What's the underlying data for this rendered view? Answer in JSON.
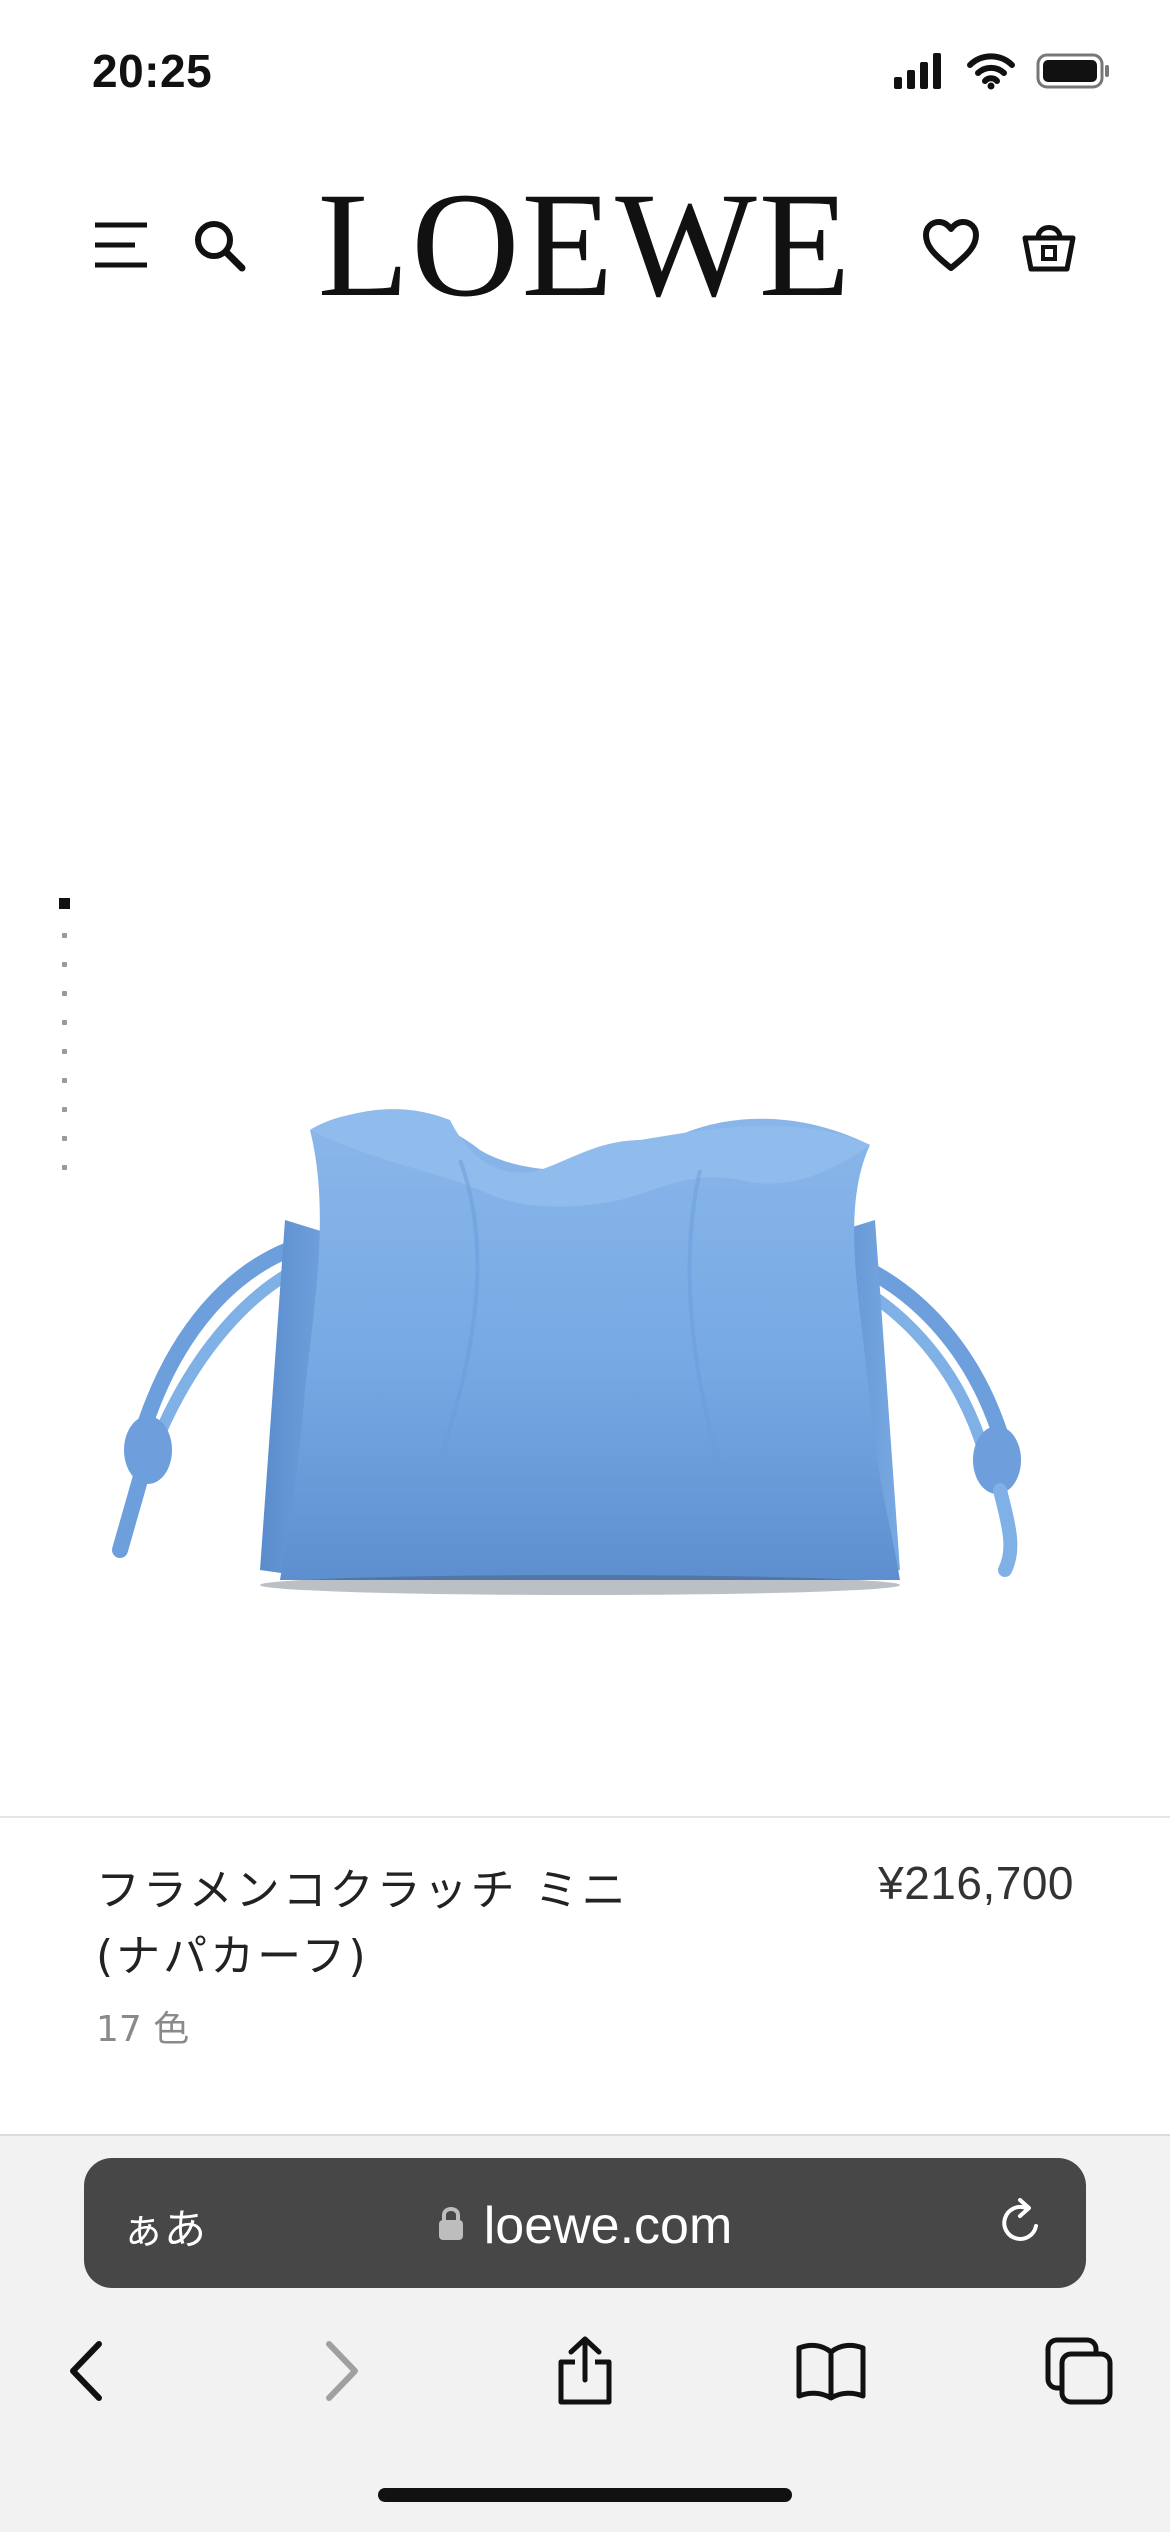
{
  "status_bar": {
    "time": "20:25",
    "icons": [
      "signal-icon",
      "wifi-icon",
      "battery-icon"
    ]
  },
  "header": {
    "logo_text": "LOEWE",
    "icons": [
      "menu-icon",
      "search-icon",
      "heart-icon",
      "basket-icon"
    ]
  },
  "gallery": {
    "image_description_icon": "bag-image",
    "swipe_hint_icon": "swipe-up-hand-icon",
    "page_indicator": {
      "total_dots": 10,
      "active_index": 0
    },
    "actions": [
      "favorite-heart-icon",
      "share-icon"
    ]
  },
  "product": {
    "name_line1": "フラメンコクラッチ ミニ",
    "name_line2": "(ナパカーフ)",
    "price": "¥216,700",
    "colors": "17 色",
    "bag_color": "#76a8e3"
  },
  "browser": {
    "text_size_label": "ぁあ",
    "domain": "loewe.com",
    "toolbar": [
      "back-icon",
      "forward-icon",
      "share-icon",
      "bookmarks-icon",
      "tabs-icon"
    ]
  }
}
